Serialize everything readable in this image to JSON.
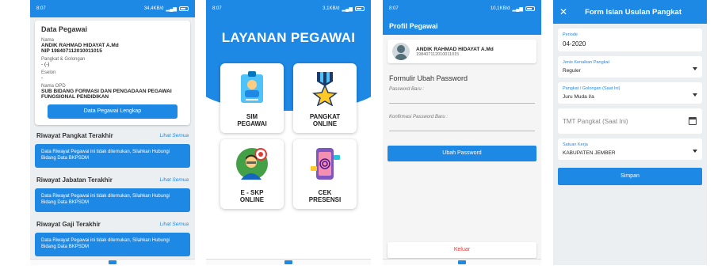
{
  "phone1": {
    "status": {
      "time": "8:07",
      "info": "34,4KB/d"
    },
    "card": {
      "title": "Data Pegawai",
      "nama_label": "Nama",
      "nama_value": "ANDIK RAHMAD HIDAYAT A.Md",
      "nip": "NIP 198407112010011015",
      "pangkat_label": "Pangkat & Golongan",
      "pangkat_value": "- (-)",
      "eselon_label": "Eselon",
      "eselon_value": "-",
      "opd_label": "Nama OPD",
      "opd_value": "SUB BIDANG FORMASI DAN PENGADAAN PEGAWAI FUNGSIONAL PENDIDIKAN",
      "button": "Data Pegawai Lengkap"
    },
    "sections": [
      {
        "title": "Riwayat Pangkat Terakhir",
        "link": "Lihat Semua",
        "message": "Data Riwayat Pegawai ini tidak ditemukan, Silahkan Hubungi Bidang Data BKPSDM"
      },
      {
        "title": "Riwayat Jabatan Terakhir",
        "link": "Lihat Semua",
        "message": "Data Riwayat Pegawai ini tidak ditemukan, Silahkan Hubungi Bidang Data BKPSDM"
      },
      {
        "title": "Riwayat Gaji Terakhir",
        "link": "Lihat Semua",
        "message": "Data Riwayat Pegawai ini tidak ditemukan, Silahkan Hubungi Bidang Data BKPSDM"
      }
    ]
  },
  "phone2": {
    "status": {
      "time": "8:07",
      "info": "3,1KB/d"
    },
    "title": "LAYANAN PEGAWAI",
    "tiles": [
      {
        "line1": "SIM",
        "line2": "PEGAWAI",
        "icon": "id-badge-icon"
      },
      {
        "line1": "PANGKAT",
        "line2": "ONLINE",
        "icon": "medal-icon"
      },
      {
        "line1": "E - SKP",
        "line2": "ONLINE",
        "icon": "target-person-icon"
      },
      {
        "line1": "CEK",
        "line2": "PRESENSI",
        "icon": "fingerprint-phone-icon"
      }
    ]
  },
  "phone3": {
    "status": {
      "time": "8:07",
      "info": "10,1KB/d"
    },
    "appbar_title": "Profil Pegawai",
    "name": "ANDIK RAHMAD HIDAYAT A.Md",
    "nip": "198407112010011015",
    "form_title": "Formulir Ubah Password",
    "field1": "Password Baru :",
    "field2": "Konfirmasi Password Baru :",
    "submit": "Ubah Password",
    "logout": "Keluar"
  },
  "phone4": {
    "appbar_title": "Form Isian Usulan Pangkat",
    "close": "✕",
    "periode_label": "Periode",
    "periode_value": "04-2020",
    "jenis_label": "Jenis Kenaikan Pangkat",
    "jenis_value": "Reguler",
    "gol_label": "Pangkat / Golongan (Saat Ini)",
    "gol_value": "Juru Muda I/a",
    "tmt_placeholder": "TMT Pangkat (Saat Ini)",
    "satuan_label": "Satuan Kerja",
    "satuan_value": "KABUPATEN JEMBER",
    "submit": "Simpan"
  }
}
